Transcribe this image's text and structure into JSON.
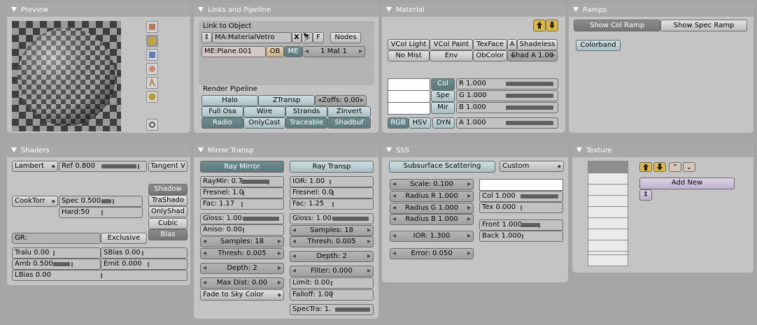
{
  "preview": {
    "title": "Preview",
    "shapes": [
      "plane-icon",
      "sphere-icon",
      "cube-icon",
      "monkey-icon",
      "hair-icon",
      "sky-icon"
    ],
    "render_icon": "circle-icon"
  },
  "links": {
    "title": "Links and Pipeline",
    "link_to_object": "Link to Object",
    "material_name": "MA:MaterialVetro",
    "x": "X",
    "f": "F",
    "nodes": "Nodes",
    "mesh_name": "ME:Plane.001",
    "ob": "OB",
    "me": "ME",
    "mat_count": "1 Mat 1",
    "render_pipeline": "Render Pipeline",
    "halo": "Halo",
    "ztransp": "ZTransp",
    "zoffs": "Zoffs: 0.00",
    "full_osa": "Full Osa",
    "wire": "Wire",
    "strands": "Strands",
    "zinvert": "ZInvert",
    "radio": "Radio",
    "onlycast": "OnlyCast",
    "traceable": "Traceable",
    "shadbuf": "Shadbuf"
  },
  "material": {
    "title": "Material",
    "vcol_light": "VCol Light",
    "vcol_paint": "VCol Paint",
    "texface": "TexFace",
    "a": "A",
    "shadeless": "Shadeless",
    "no_mist": "No Mist",
    "env": "Env",
    "obcolor": "ObColor",
    "shad_a": "Shad A 1.00",
    "col": "Col",
    "spe": "Spe",
    "mir": "Mir",
    "r": "R 1.000",
    "g": "G 1.000",
    "b": "B 1.000",
    "rgb": "RGB",
    "hsv": "HSV",
    "dyn": "DYN",
    "alpha": "A 1.000"
  },
  "ramps": {
    "title": "Ramps",
    "picker_options": [
      "Show Col Ramp",
      "Show Spec Ramp"
    ],
    "picker_selected": "Show Col Ramp",
    "colorband": "Colorband"
  },
  "shaders": {
    "title": "Shaders",
    "diffuse": "Lambert",
    "ref": "Ref  0.800",
    "tangent": "Tangent V",
    "spec_shader": "CookTorr",
    "spec": "Spec 0.500",
    "hard": "Hard:50",
    "shadow": "Shadow",
    "trashado": "TraShado",
    "onlyshad": "OnlyShad",
    "cubic": "Cubic",
    "bias": "Bias",
    "gr": "GR:",
    "exclusive": "Exclusive",
    "tralu": "Tralu 0.00",
    "sbias": "SBias 0.00",
    "amb": "Amb 0.500",
    "emit": "Emit 0.000",
    "lbias": "LBias 0.00"
  },
  "mirror": {
    "title": "Mirror Transp",
    "ray_mirror": "Ray Mirror",
    "ray_transp": "Ray Transp",
    "raymir": "RayMir: 0.7",
    "ior": "IOR: 1.00",
    "fresnel_l": "Fresnel: 1.0",
    "fresnel_r": "Fresnel: 0.0",
    "fac_l": "Fac: 1.17",
    "fac_r": "Fac: 1.25",
    "gloss_l": "Gloss: 1.00",
    "gloss_r": "Gloss: 1.00",
    "aniso": "Aniso: 0.00",
    "samples_l": "Samples: 18",
    "samples_r": "Samples: 18",
    "thresh_l": "Thresh: 0.005",
    "thresh_r": "Thresh: 0.005",
    "depth_l": "Depth: 2",
    "depth_r": "Depth: 2",
    "filter": "Filter: 0.000",
    "maxdist": "Max Dist: 0.00",
    "limit": "Limit: 0.00",
    "fade": "Fade to Sky Color",
    "falloff": "Falloff: 1.00",
    "spectra": "SpecTra: 1."
  },
  "sss": {
    "title": "SSS",
    "sss_button": "Subsurface Scattering",
    "preset": "Custom",
    "scale": "Scale: 0.100",
    "radius_r": "Radius R 1.000",
    "radius_g": "Radius G 1.000",
    "radius_b": "Radius B 1.000",
    "ior": "IOR: 1.300",
    "error": "Error: 0.050",
    "col": "Col 1.000",
    "tex": "Tex 0.000",
    "front": "Front 1.000",
    "back": "Back 1.000"
  },
  "texture": {
    "title": "Texture",
    "add_new": "Add New"
  }
}
